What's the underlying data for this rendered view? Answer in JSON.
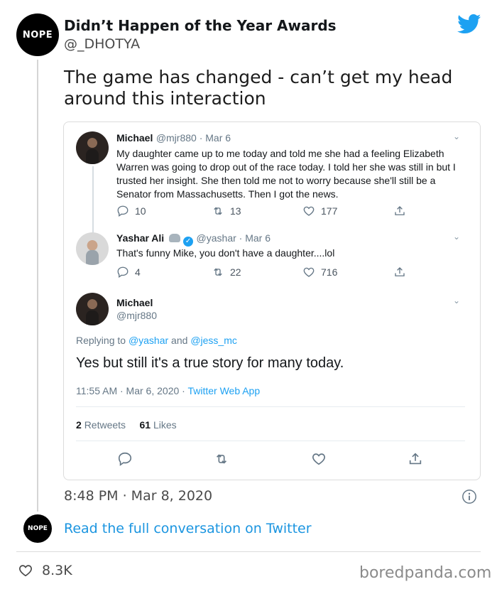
{
  "outer_tweet": {
    "avatar_text": "NOPE",
    "author_name": "Didn’t Happen of the Year Awards",
    "author_handle": "@_DHOTYA",
    "text": "The game has changed - can’t get my head around this interaction",
    "timestamp": "8:48 PM · Mar 8, 2020",
    "read_more": "Read the full conversation on Twitter",
    "likes": "8.3K",
    "small_avatar_text": "NOPE"
  },
  "embedded": {
    "tweet1": {
      "name": "Michael",
      "meta": "@mjr880 · Mar 6",
      "text": "My daughter came up to me today and told me she had a feeling Elizabeth Warren was going to drop out of the race today. I told her she was still in but I trusted her insight. She then told me not to worry because she'll still be a Senator from Massachusetts. Then I got the news.",
      "replies": "10",
      "retweets": "13",
      "likes": "177"
    },
    "tweet2": {
      "name": "Yashar Ali",
      "meta": "@yashar · Mar 6",
      "text": "That's funny Mike, you don't have a daughter....lol",
      "replies": "4",
      "retweets": "22",
      "likes": "716"
    },
    "tweet3": {
      "name": "Michael",
      "handle": "@mjr880",
      "replying_prefix": "Replying to ",
      "replying_user1": "@yashar",
      "replying_and": " and ",
      "replying_user2": "@jess_mc",
      "text": "Yes but still it's a true story for many today.",
      "time_date": "11:55 AM · Mar 6, 2020 · ",
      "source": "Twitter Web App",
      "retweets_count": "2",
      "retweets_label": "Retweets",
      "likes_count": "61",
      "likes_label": "Likes"
    }
  },
  "watermark": "boredpanda.com",
  "colors": {
    "twitter_blue": "#1da1f2",
    "link_blue": "#1b95e0",
    "text": "#14171a"
  }
}
